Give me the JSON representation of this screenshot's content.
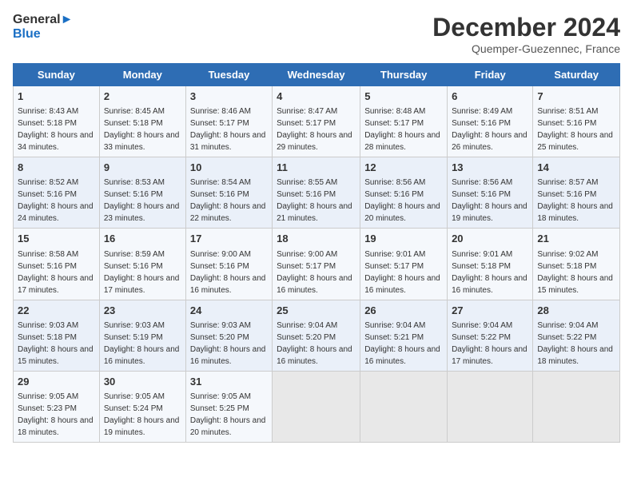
{
  "header": {
    "logo_line1": "General",
    "logo_line2": "Blue",
    "month": "December 2024",
    "location": "Quemper-Guezennec, France"
  },
  "weekdays": [
    "Sunday",
    "Monday",
    "Tuesday",
    "Wednesday",
    "Thursday",
    "Friday",
    "Saturday"
  ],
  "weeks": [
    [
      {
        "day": "1",
        "sunrise": "8:43 AM",
        "sunset": "5:18 PM",
        "daylight": "8 hours and 34 minutes."
      },
      {
        "day": "2",
        "sunrise": "8:45 AM",
        "sunset": "5:18 PM",
        "daylight": "8 hours and 33 minutes."
      },
      {
        "day": "3",
        "sunrise": "8:46 AM",
        "sunset": "5:17 PM",
        "daylight": "8 hours and 31 minutes."
      },
      {
        "day": "4",
        "sunrise": "8:47 AM",
        "sunset": "5:17 PM",
        "daylight": "8 hours and 29 minutes."
      },
      {
        "day": "5",
        "sunrise": "8:48 AM",
        "sunset": "5:17 PM",
        "daylight": "8 hours and 28 minutes."
      },
      {
        "day": "6",
        "sunrise": "8:49 AM",
        "sunset": "5:16 PM",
        "daylight": "8 hours and 26 minutes."
      },
      {
        "day": "7",
        "sunrise": "8:51 AM",
        "sunset": "5:16 PM",
        "daylight": "8 hours and 25 minutes."
      }
    ],
    [
      {
        "day": "8",
        "sunrise": "8:52 AM",
        "sunset": "5:16 PM",
        "daylight": "8 hours and 24 minutes."
      },
      {
        "day": "9",
        "sunrise": "8:53 AM",
        "sunset": "5:16 PM",
        "daylight": "8 hours and 23 minutes."
      },
      {
        "day": "10",
        "sunrise": "8:54 AM",
        "sunset": "5:16 PM",
        "daylight": "8 hours and 22 minutes."
      },
      {
        "day": "11",
        "sunrise": "8:55 AM",
        "sunset": "5:16 PM",
        "daylight": "8 hours and 21 minutes."
      },
      {
        "day": "12",
        "sunrise": "8:56 AM",
        "sunset": "5:16 PM",
        "daylight": "8 hours and 20 minutes."
      },
      {
        "day": "13",
        "sunrise": "8:56 AM",
        "sunset": "5:16 PM",
        "daylight": "8 hours and 19 minutes."
      },
      {
        "day": "14",
        "sunrise": "8:57 AM",
        "sunset": "5:16 PM",
        "daylight": "8 hours and 18 minutes."
      }
    ],
    [
      {
        "day": "15",
        "sunrise": "8:58 AM",
        "sunset": "5:16 PM",
        "daylight": "8 hours and 17 minutes."
      },
      {
        "day": "16",
        "sunrise": "8:59 AM",
        "sunset": "5:16 PM",
        "daylight": "8 hours and 17 minutes."
      },
      {
        "day": "17",
        "sunrise": "9:00 AM",
        "sunset": "5:16 PM",
        "daylight": "8 hours and 16 minutes."
      },
      {
        "day": "18",
        "sunrise": "9:00 AM",
        "sunset": "5:17 PM",
        "daylight": "8 hours and 16 minutes."
      },
      {
        "day": "19",
        "sunrise": "9:01 AM",
        "sunset": "5:17 PM",
        "daylight": "8 hours and 16 minutes."
      },
      {
        "day": "20",
        "sunrise": "9:01 AM",
        "sunset": "5:18 PM",
        "daylight": "8 hours and 16 minutes."
      },
      {
        "day": "21",
        "sunrise": "9:02 AM",
        "sunset": "5:18 PM",
        "daylight": "8 hours and 15 minutes."
      }
    ],
    [
      {
        "day": "22",
        "sunrise": "9:03 AM",
        "sunset": "5:18 PM",
        "daylight": "8 hours and 15 minutes."
      },
      {
        "day": "23",
        "sunrise": "9:03 AM",
        "sunset": "5:19 PM",
        "daylight": "8 hours and 16 minutes."
      },
      {
        "day": "24",
        "sunrise": "9:03 AM",
        "sunset": "5:20 PM",
        "daylight": "8 hours and 16 minutes."
      },
      {
        "day": "25",
        "sunrise": "9:04 AM",
        "sunset": "5:20 PM",
        "daylight": "8 hours and 16 minutes."
      },
      {
        "day": "26",
        "sunrise": "9:04 AM",
        "sunset": "5:21 PM",
        "daylight": "8 hours and 16 minutes."
      },
      {
        "day": "27",
        "sunrise": "9:04 AM",
        "sunset": "5:22 PM",
        "daylight": "8 hours and 17 minutes."
      },
      {
        "day": "28",
        "sunrise": "9:04 AM",
        "sunset": "5:22 PM",
        "daylight": "8 hours and 18 minutes."
      }
    ],
    [
      {
        "day": "29",
        "sunrise": "9:05 AM",
        "sunset": "5:23 PM",
        "daylight": "8 hours and 18 minutes."
      },
      {
        "day": "30",
        "sunrise": "9:05 AM",
        "sunset": "5:24 PM",
        "daylight": "8 hours and 19 minutes."
      },
      {
        "day": "31",
        "sunrise": "9:05 AM",
        "sunset": "5:25 PM",
        "daylight": "8 hours and 20 minutes."
      },
      null,
      null,
      null,
      null
    ]
  ]
}
